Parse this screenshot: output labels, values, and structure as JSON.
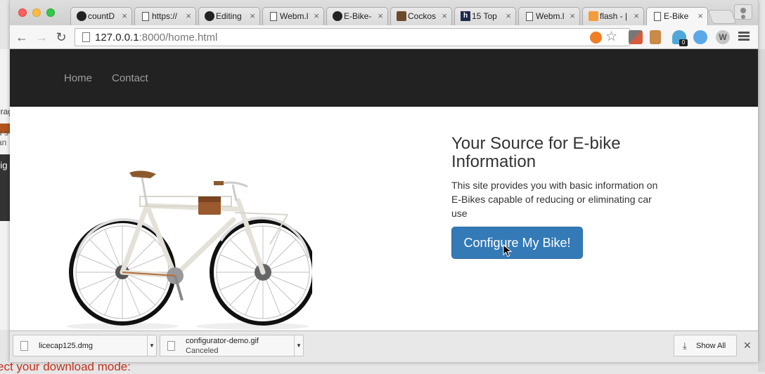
{
  "background_window": {
    "left_text_1": "erag",
    "left_text_2": "u s an",
    "left_dark_text": "rig",
    "bottom_text": "ect your download mode:"
  },
  "tabs": [
    {
      "title": "countD",
      "icon": "github-icon"
    },
    {
      "title": "https://",
      "icon": "document-icon"
    },
    {
      "title": "Editing",
      "icon": "github-icon"
    },
    {
      "title": "Webm.l",
      "icon": "document-icon"
    },
    {
      "title": "E-Bike-",
      "icon": "github-icon"
    },
    {
      "title": "Cockos",
      "icon": "cockos-icon"
    },
    {
      "title": "15 Top",
      "icon": "h-logo-icon"
    },
    {
      "title": "Webm.l",
      "icon": "document-icon"
    },
    {
      "title": "flash - |",
      "icon": "flash-icon"
    },
    {
      "title": "E-Bike",
      "icon": "document-icon",
      "active": true
    }
  ],
  "address_bar": {
    "host": "127.0.0.1",
    "rest": ":8000/home.html"
  },
  "extension_badge": "0",
  "extension_w_label": "W",
  "site": {
    "nav": {
      "home": "Home",
      "contact": "Contact"
    },
    "hero_title": "Your Source for E-bike Information",
    "hero_description": "This site provides you with basic information on E-Bikes capable of reducing or eliminating car use",
    "cta_label": "Configure My Bike!"
  },
  "downloads": [
    {
      "filename": "licecap125.dmg",
      "status": ""
    },
    {
      "filename": "configurator-demo.gif",
      "status": "Canceled"
    }
  ],
  "show_all_label": "Show All",
  "colors": {
    "navbar": "#222222",
    "primary_button": "#337ab7"
  }
}
